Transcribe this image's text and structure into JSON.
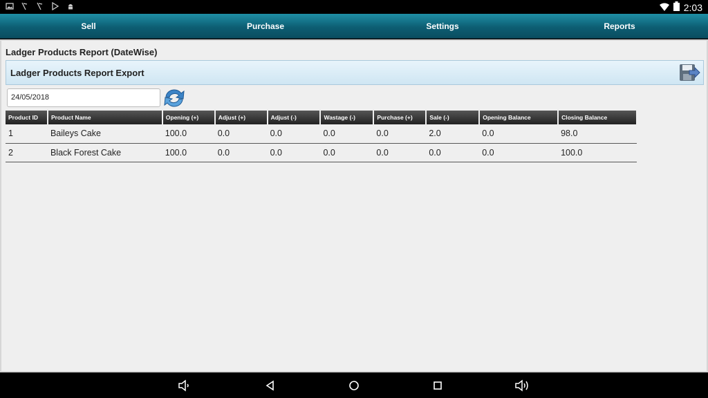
{
  "statusbar": {
    "left_icons": [
      "image-icon",
      "signal-tool-icon",
      "signal-tool-icon",
      "play-store-icon",
      "android-icon"
    ],
    "time": "2:03"
  },
  "tabs": [
    {
      "label": "Sell"
    },
    {
      "label": "Purchase"
    },
    {
      "label": "Settings"
    },
    {
      "label": "Reports"
    }
  ],
  "report": {
    "title": "Ladger Products Report (DateWise)",
    "export_label": "Ladger Products Report Export",
    "date_value": "24/05/2018"
  },
  "table": {
    "headers": [
      "Product ID",
      "Product Name",
      "Opening (+)",
      "Adjust (+)",
      "Adjust (-)",
      "Wastage (-)",
      "Purchase (+)",
      "Sale (-)",
      "Opening Balance",
      "Closing Balance"
    ],
    "rows": [
      [
        "1",
        "Baileys Cake",
        "100.0",
        "0.0",
        "0.0",
        "0.0",
        "0.0",
        "2.0",
        "0.0",
        "98.0"
      ],
      [
        "2",
        "Black Forest Cake",
        "100.0",
        "0.0",
        "0.0",
        "0.0",
        "0.0",
        "0.0",
        "0.0",
        "100.0"
      ]
    ]
  },
  "colors": {
    "tab_bar": "#0d5e73",
    "header_bar": "#cfe6f3",
    "table_header": "#222222"
  }
}
